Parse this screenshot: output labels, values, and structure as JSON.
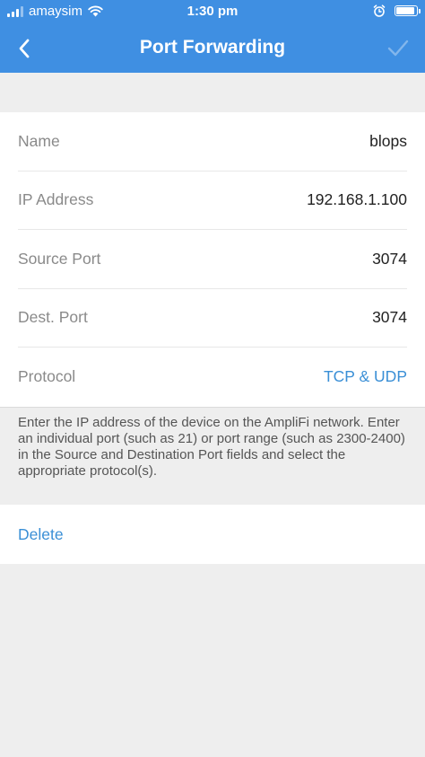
{
  "status_bar": {
    "carrier": "amaysim",
    "time": "1:30 pm"
  },
  "nav": {
    "title": "Port Forwarding",
    "back_icon": "chevron-left-icon",
    "save_icon": "checkmark-icon"
  },
  "colors": {
    "header": "#3f8fe2",
    "accent": "#3a8fd6",
    "background": "#eeeeee"
  },
  "form": {
    "rows": [
      {
        "label": "Name",
        "value": "blops"
      },
      {
        "label": "IP Address",
        "value": "192.168.1.100"
      },
      {
        "label": "Source Port",
        "value": "3074"
      },
      {
        "label": "Dest. Port",
        "value": "3074"
      },
      {
        "label": "Protocol",
        "value": "TCP & UDP"
      }
    ]
  },
  "help_text": "Enter the IP address of the device on the AmpliFi network. Enter an individual port (such as 21) or port range (such as 2300-2400) in the Source and Destination Port fields and select the appropriate protocol(s).",
  "delete_label": "Delete"
}
